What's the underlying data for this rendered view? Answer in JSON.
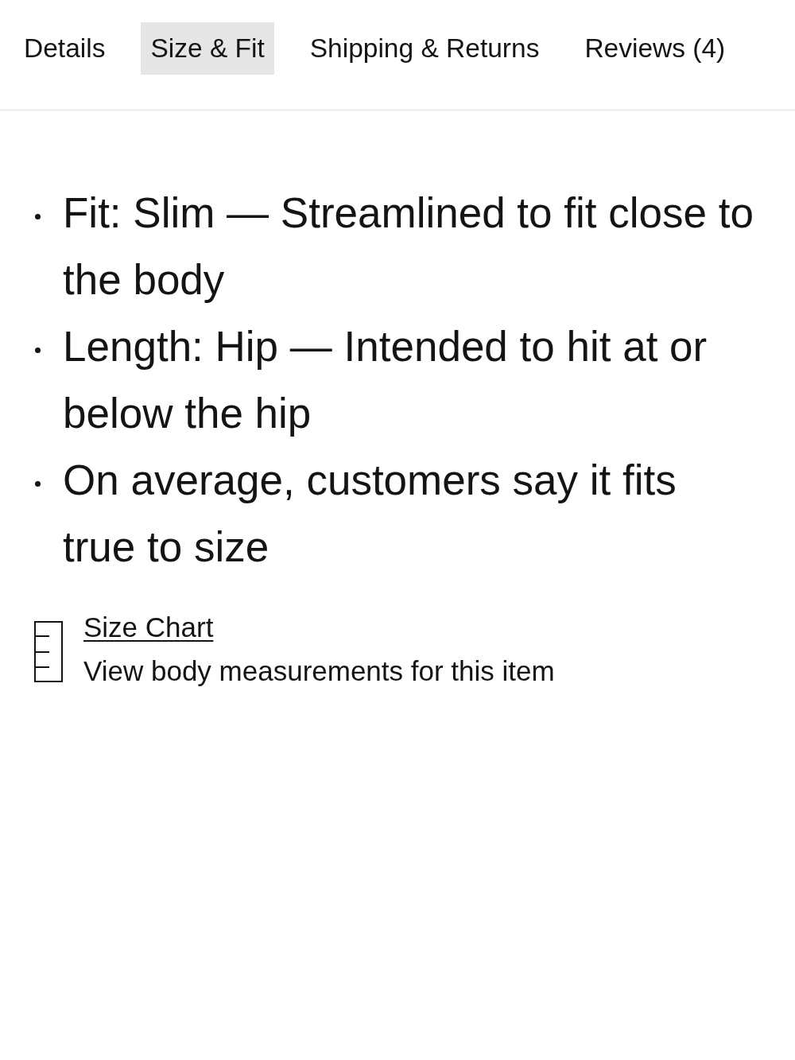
{
  "tabs": [
    {
      "label": "Details",
      "selected": false
    },
    {
      "label": "Size & Fit",
      "selected": true
    },
    {
      "label": "Shipping & Returns",
      "selected": false
    },
    {
      "label": "Reviews (4)",
      "selected": false
    }
  ],
  "fit_details": [
    "Fit: Slim — Streamlined to fit close to the body",
    "Length: Hip — Intended to hit at or below the hip",
    "On average, customers say it fits true to size"
  ],
  "size_chart": {
    "link": "Size Chart",
    "description": "View body measurements for this item"
  }
}
